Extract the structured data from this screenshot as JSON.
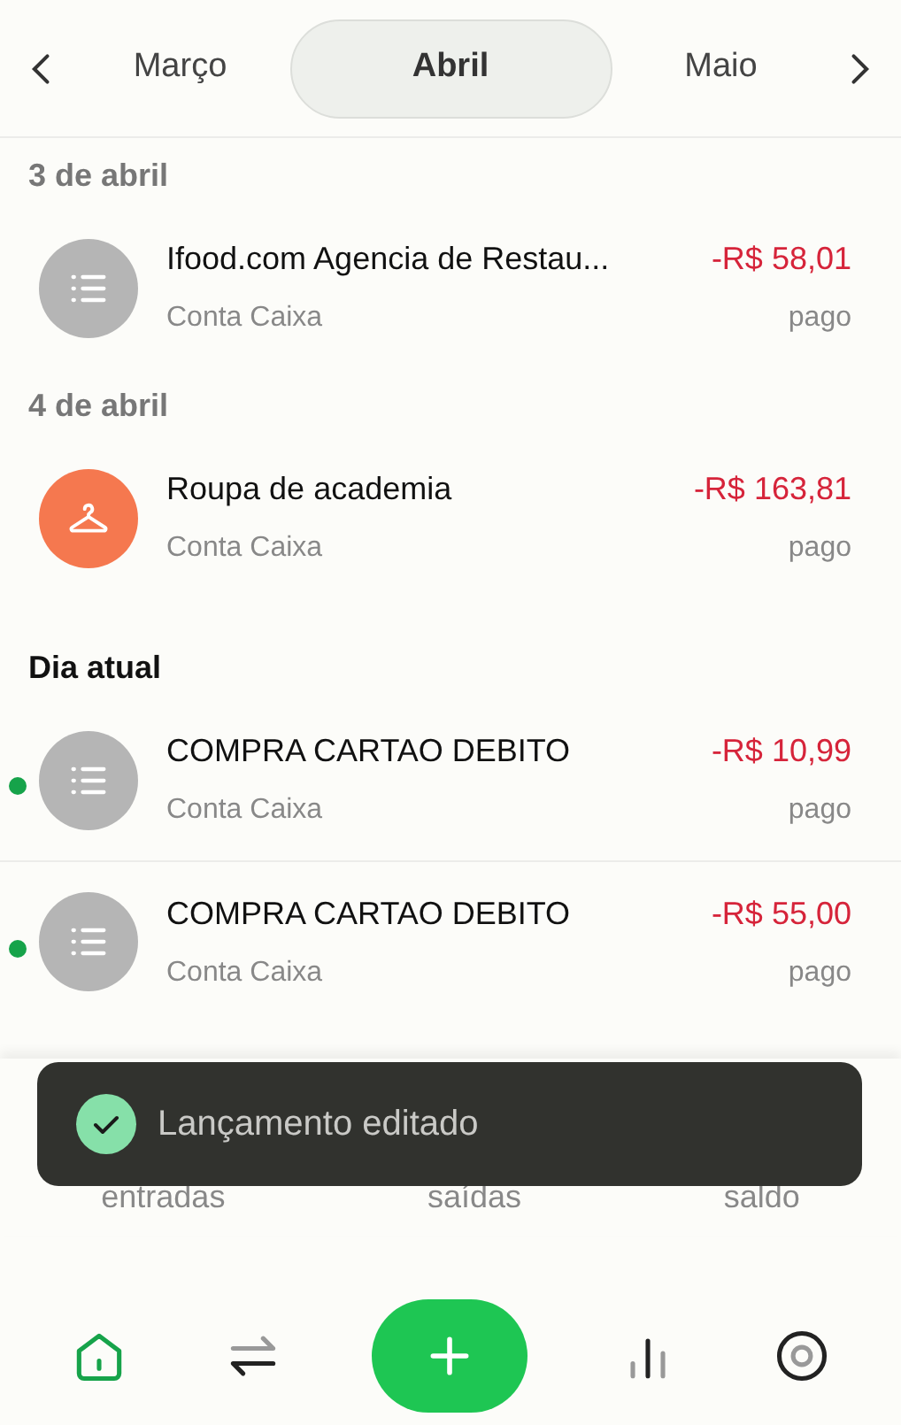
{
  "month_nav": {
    "months": [
      {
        "label": "Março",
        "selected": false
      },
      {
        "label": "Abril",
        "selected": true
      },
      {
        "label": "Maio",
        "selected": false
      }
    ]
  },
  "sections": [
    {
      "title": "3 de abril",
      "current": false,
      "items": [
        {
          "kind": "list",
          "title": "Ifood.com Agencia de Restau...",
          "account": "Conta Caixa",
          "amount": "-R$ 58,01",
          "status": "pago",
          "new": false
        }
      ]
    },
    {
      "title": "4 de abril",
      "current": false,
      "items": [
        {
          "kind": "clothes",
          "title": "Roupa de academia",
          "account": "Conta Caixa",
          "amount": "-R$ 163,81",
          "status": "pago",
          "new": false
        }
      ]
    },
    {
      "title": "Dia atual",
      "current": true,
      "items": [
        {
          "kind": "list",
          "title": "COMPRA CARTAO DEBITO",
          "account": "Conta Caixa",
          "amount": "-R$ 10,99",
          "status": "pago",
          "new": true
        },
        {
          "kind": "list",
          "title": "COMPRA CARTAO DEBITO",
          "account": "Conta Caixa",
          "amount": "-R$ 55,00",
          "status": "pago",
          "new": true
        }
      ]
    }
  ],
  "summary": {
    "labels": [
      "entradas",
      "saídas",
      "saldo"
    ]
  },
  "toast": {
    "message": "Lançamento editado"
  },
  "bottom_nav": [
    {
      "kind": "home",
      "selected": true
    },
    {
      "kind": "transfer",
      "selected": false
    },
    {
      "kind": "add",
      "selected": false
    },
    {
      "kind": "chart",
      "selected": false
    },
    {
      "kind": "goal",
      "selected": false
    }
  ]
}
